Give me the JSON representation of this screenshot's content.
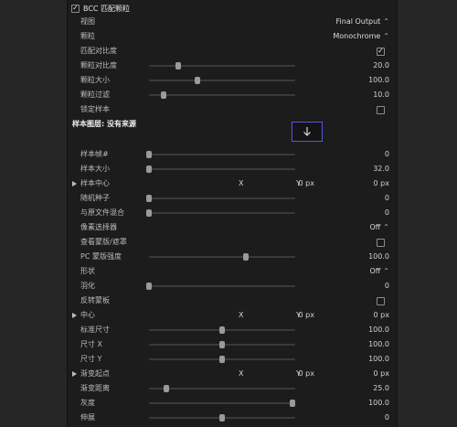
{
  "header": {
    "enabled": true,
    "title": "BCC 匹配颗粒"
  },
  "rows": {
    "view": {
      "label": "视图",
      "value": "Final Output"
    },
    "grain": {
      "label": "颗粒",
      "value": "Monochrome"
    },
    "match_contrast": {
      "label": "匹配对比度",
      "checked": true
    },
    "grain_contrast": {
      "label": "颗粒对比度",
      "value": "20.0",
      "level": 0.2
    },
    "grain_size": {
      "label": "颗粒大小",
      "value": "100.0",
      "level": 0.33
    },
    "grain_filter": {
      "label": "颗粒过滤",
      "value": "10.0",
      "level": 0.1
    },
    "lock_sample": {
      "label": "锁定样本",
      "checked": false
    },
    "sample_layer": {
      "label": "样本图层: 没有来源"
    },
    "sample_frames": {
      "label": "样本帧#",
      "value": "0",
      "level": 0.0
    },
    "sample_size": {
      "label": "样本大小",
      "value": "32.0",
      "level": 0.0
    },
    "sample_center": {
      "label": "样本中心",
      "x_label": "X",
      "x_value": "0 px",
      "y_label": "Y",
      "y_value": "0 px"
    },
    "random_seed": {
      "label": "随机种子",
      "value": "0",
      "level": 0.0
    },
    "blend_original": {
      "label": "与原文件混合",
      "value": "0",
      "level": 0.0
    },
    "pixel_selector": {
      "label": "像素选择器",
      "value": "Off"
    },
    "view_matte": {
      "label": "查看蒙版/遮罩",
      "checked": false
    },
    "pc_matte": {
      "label": "PC 蒙版强度",
      "value": "100.0",
      "level": 0.66
    },
    "shape": {
      "label": "形状",
      "value": "Off"
    },
    "feather": {
      "label": "羽化",
      "value": "0",
      "level": 0.0
    },
    "invert_matte": {
      "label": "反转蒙板",
      "checked": false
    },
    "center": {
      "label": "中心",
      "x_label": "X",
      "x_value": "0 px",
      "y_label": "Y",
      "y_value": "0 px"
    },
    "std_size": {
      "label": "标准尺寸",
      "value": "100.0",
      "level": 0.5
    },
    "size_x": {
      "label": "尺寸 X",
      "value": "100.0",
      "level": 0.5
    },
    "size_y": {
      "label": "尺寸 Y",
      "value": "100.0",
      "level": 0.5
    },
    "gradient_start": {
      "label": "渐变起点",
      "x_label": "X",
      "x_value": "0 px",
      "y_label": "Y",
      "y_value": "0 px"
    },
    "gradient_dist": {
      "label": "渐变距离",
      "value": "25.0",
      "level": 0.12
    },
    "gray": {
      "label": "灰度",
      "value": "100.0",
      "level": 0.98
    },
    "stretch": {
      "label": "伸展",
      "value": "0",
      "level": 0.5
    }
  },
  "icons": {
    "popup": "chevron-updown-icon",
    "well": "down-arrow-icon",
    "disclosure": "triangle-right-icon",
    "checkbox": "checkbox-icon"
  },
  "colors": {
    "panel": "#1c1c1c",
    "accent": "#5a58d8",
    "background": "#262626"
  }
}
